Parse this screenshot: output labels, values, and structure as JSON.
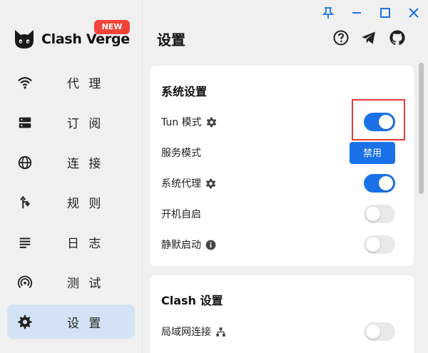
{
  "app": {
    "name": "Clash Verge",
    "badge": "NEW"
  },
  "sidebar": {
    "items": [
      {
        "label": "代 理",
        "icon": "wifi-icon"
      },
      {
        "label": "订 阅",
        "icon": "storage-icon"
      },
      {
        "label": "连 接",
        "icon": "globe-icon"
      },
      {
        "label": "规 则",
        "icon": "fork-arrow-icon"
      },
      {
        "label": "日 志",
        "icon": "list-lines-icon"
      },
      {
        "label": "测 试",
        "icon": "broadcast-icon"
      },
      {
        "label": "设 置",
        "icon": "gear-icon",
        "active": true
      }
    ]
  },
  "header": {
    "title": "设置",
    "icons": [
      "help-icon",
      "telegram-icon",
      "github-icon"
    ]
  },
  "window_controls": [
    "pin-icon",
    "minimize-icon",
    "maximize-icon",
    "close-icon"
  ],
  "system_settings": {
    "title": "系统设置",
    "rows": [
      {
        "label": "Tun 模式",
        "icon": "gear-icon",
        "toggle": true
      },
      {
        "label": "服务模式",
        "button": "禁用"
      },
      {
        "label": "系统代理",
        "icon": "gear-icon",
        "toggle": true
      },
      {
        "label": "开机自启",
        "toggle": false
      },
      {
        "label": "静默启动",
        "icon": "info-icon",
        "toggle": false
      }
    ]
  },
  "clash_settings": {
    "title": "Clash 设置",
    "rows": [
      {
        "label": "局域网连接",
        "icon": "network-icon",
        "toggle": false
      }
    ]
  },
  "colors": {
    "accent": "#1b72e8",
    "active_nav": "#d3e3f5",
    "badge": "#f0443a",
    "highlight": "#e03b3b"
  }
}
